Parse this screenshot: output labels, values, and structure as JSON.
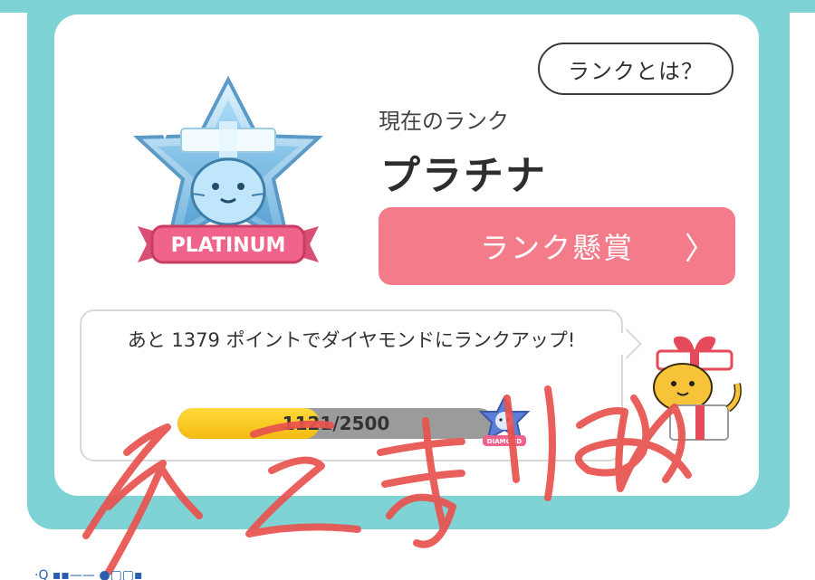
{
  "header": {
    "help_button": "ランクとは？",
    "current_rank_label": "現在のランク",
    "current_rank": "プラチナ",
    "badge_label": "PLATINUM",
    "reward_button": "ランク懸賞",
    "reward_chevron": "〉"
  },
  "progress": {
    "message": "あと 1379 ポイントでダイヤモンドにランクアップ!",
    "current": 1121,
    "target": 2500,
    "display": "1121/2500",
    "next_rank_badge_label": "DIAMOND"
  },
  "annotation": {
    "handwritten": "ネてまりね"
  },
  "colors": {
    "teal": "#7fd3d5",
    "pink_button": "#f47c8a",
    "progress_fill": "#f4bb12",
    "progress_track": "#9b9b9b",
    "scribble": "#e8524f"
  },
  "icons": [
    "platinum-rank-badge-icon",
    "diamond-rank-badge-icon",
    "gift-cat-mascot-icon",
    "chevron-right-icon"
  ]
}
